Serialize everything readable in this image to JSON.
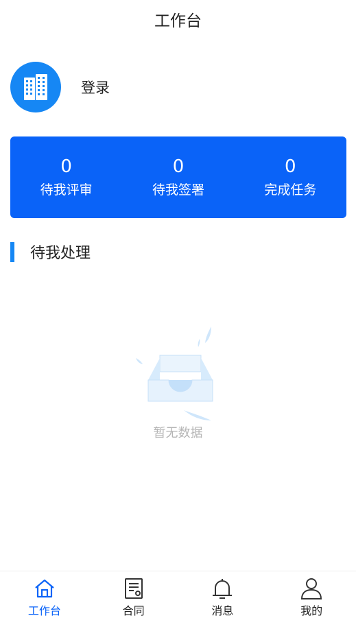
{
  "header": {
    "title": "工作台"
  },
  "user": {
    "login_label": "登录",
    "avatar_icon": "building-icon"
  },
  "stats": [
    {
      "value": "0",
      "label": "待我评审"
    },
    {
      "value": "0",
      "label": "待我签署"
    },
    {
      "value": "0",
      "label": "完成任务"
    }
  ],
  "section": {
    "title": "待我处理"
  },
  "empty_state": {
    "text": "暂无数据",
    "icon": "empty-inbox-icon"
  },
  "tabbar": {
    "items": [
      {
        "label": "工作台",
        "icon": "home-icon",
        "active": true
      },
      {
        "label": "合同",
        "icon": "contract-icon",
        "active": false
      },
      {
        "label": "消息",
        "icon": "bell-icon",
        "active": false
      },
      {
        "label": "我的",
        "icon": "user-icon",
        "active": false
      }
    ]
  },
  "colors": {
    "primary": "#0a63f8",
    "accent": "#1687f4",
    "muted_text": "#b5b5b5"
  }
}
